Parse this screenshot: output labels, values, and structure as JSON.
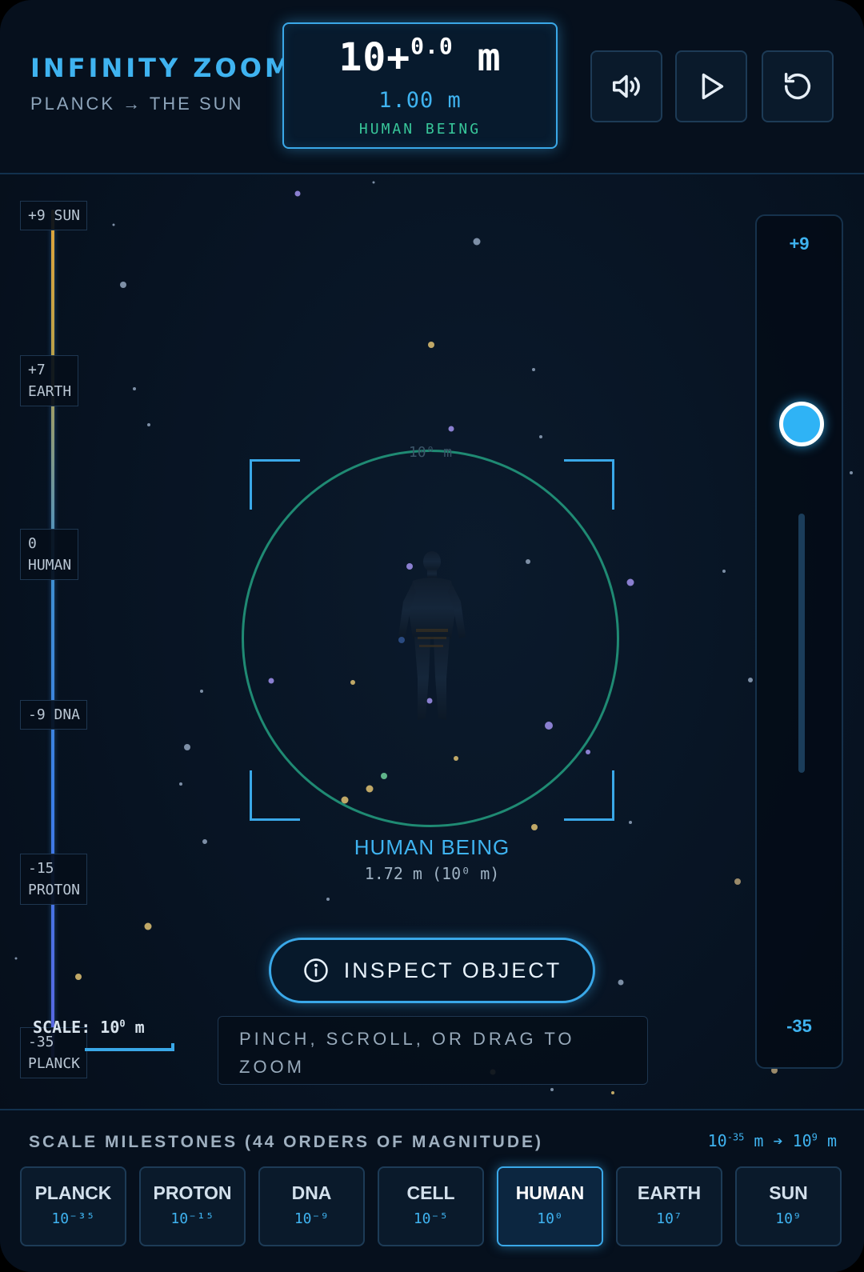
{
  "header": {
    "app_title": "INFINITY ZOOM",
    "app_subtitle": "PLANCK → THE SUN",
    "readout": {
      "base": "10+",
      "exponent": "0.0",
      "unit": "m",
      "meters": "1.00 m",
      "object_name": "HUMAN BEING"
    },
    "buttons": [
      {
        "name": "sound",
        "icon": "speaker-icon"
      },
      {
        "name": "play",
        "icon": "play-icon"
      },
      {
        "name": "reset",
        "icon": "reset-icon"
      }
    ]
  },
  "scale_markers": [
    {
      "text": "+9 SUN"
    },
    {
      "text": "+7\nEARTH"
    },
    {
      "text": "0\nHUMAN"
    },
    {
      "text": "-9 DNA"
    },
    {
      "text": "-15\nPROTON"
    },
    {
      "text": "-35\nPLANCK"
    }
  ],
  "zoom_slider": {
    "max_label": "+9",
    "min_label": "-35",
    "min": -35,
    "max": 9,
    "value": 0
  },
  "viewport": {
    "ring_label": "10⁰ m",
    "object_name": "HUMAN BEING",
    "object_size": "1.72 m (10⁰ m)",
    "inspect_label": "INSPECT OBJECT",
    "scale_prefix": "SCALE: 10",
    "scale_exp": "0",
    "scale_unit": " m",
    "hint": "PINCH, SCROLL, OR DRAG TO ZOOM"
  },
  "milestones": {
    "title": "SCALE MILESTONES (44 ORDERS OF MAGNITUDE)",
    "range_from_base": "10",
    "range_from_exp": "-35",
    "range_mid": " m ➔ 10",
    "range_to_exp": "9",
    "range_unit": " m",
    "items": [
      {
        "name": "PLANCK",
        "exp": "10⁻³⁵",
        "active": false
      },
      {
        "name": "PROTON",
        "exp": "10⁻¹⁵",
        "active": false
      },
      {
        "name": "DNA",
        "exp": "10⁻⁹",
        "active": false
      },
      {
        "name": "CELL",
        "exp": "10⁻⁵",
        "active": false
      },
      {
        "name": "HUMAN",
        "exp": "10⁰",
        "active": true
      },
      {
        "name": "EARTH",
        "exp": "10⁷",
        "active": false
      },
      {
        "name": "SUN",
        "exp": "10⁹",
        "active": false
      }
    ]
  },
  "colors": {
    "accent": "#3fb3f0",
    "ring": "#1f8a73",
    "object_label": "#38c79a",
    "background": "#071322"
  }
}
